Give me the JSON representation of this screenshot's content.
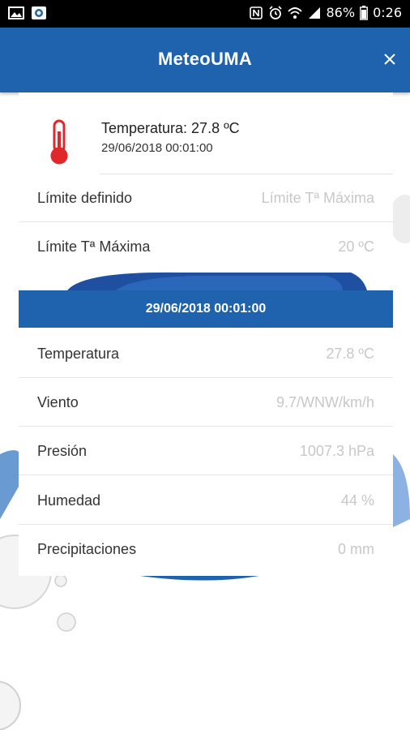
{
  "statusbar": {
    "battery": "86%",
    "time": "0:26"
  },
  "appbar": {
    "title": "MeteoUMA"
  },
  "alert": {
    "summary_title": "Temperatura: 27.8 ºC",
    "summary_date": "29/06/2018 00:01:00",
    "rows": [
      {
        "label": "Límite definido",
        "value": "Límite Tª Máxima"
      },
      {
        "label": "Límite Tª Máxima",
        "value": "20 ºC"
      }
    ]
  },
  "observation": {
    "date": "29/06/2018 00:01:00",
    "rows": [
      {
        "label": "Temperatura",
        "value": "27.8 ºC"
      },
      {
        "label": "Viento",
        "value": "9.7/WNW/km/h"
      },
      {
        "label": "Presión",
        "value": "1007.3 hPa"
      },
      {
        "label": "Humedad",
        "value": "44 %"
      },
      {
        "label": "Precipitaciones",
        "value": "0 mm"
      }
    ]
  },
  "colors": {
    "primary": "#1f63ae",
    "thermometer": "#e0282b"
  }
}
